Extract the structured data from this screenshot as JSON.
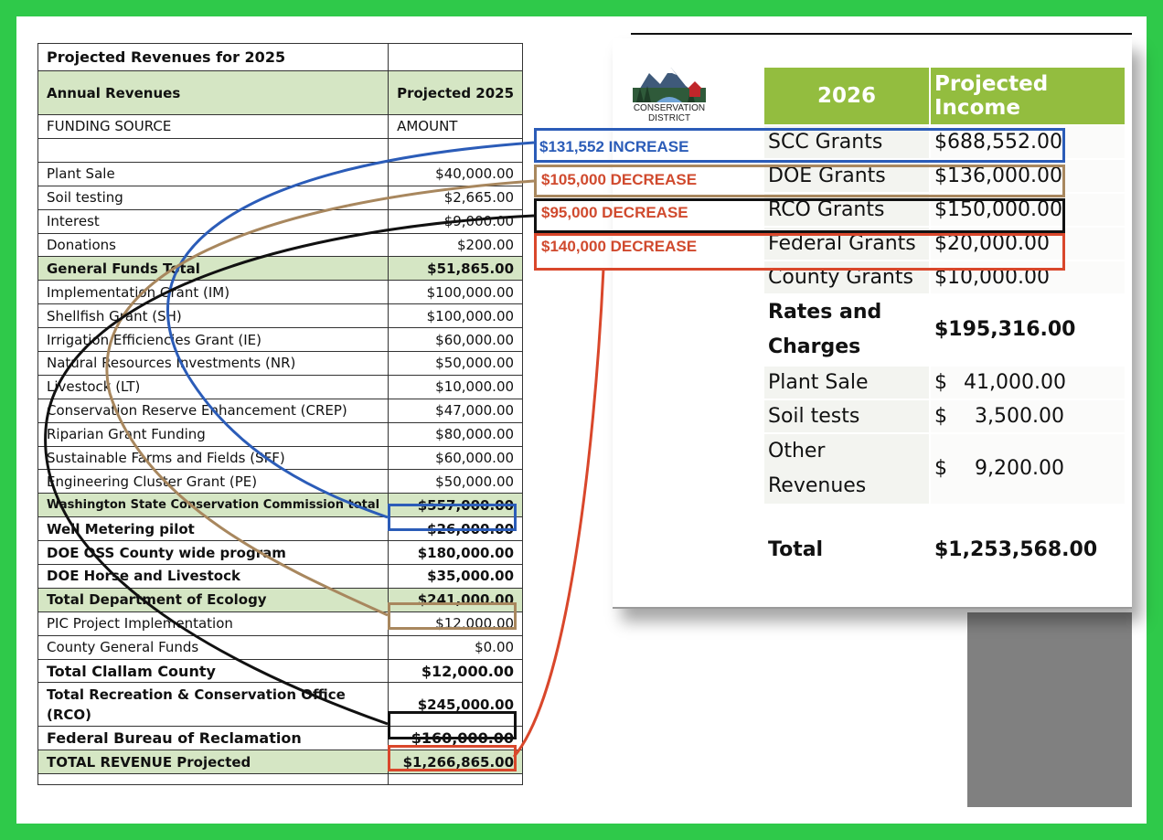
{
  "left_table": {
    "title": "Projected Revenues for 2025",
    "header": {
      "label": "Annual Revenues",
      "col": "Projected 2025"
    },
    "subheader": {
      "label": "FUNDING SOURCE",
      "col": "AMOUNT"
    },
    "rows": [
      {
        "label": "Plant Sale",
        "value": "$40,000.00"
      },
      {
        "label": "Soil testing",
        "value": "$2,665.00"
      },
      {
        "label": "Interest",
        "value": "$9,000.00"
      },
      {
        "label": "Donations",
        "value": "$200.00"
      },
      {
        "label": "General Funds Total",
        "value": "$51,865.00"
      },
      {
        "label": "Implementation Grant (IM)",
        "value": "$100,000.00"
      },
      {
        "label": "Shellfish Grant (SH)",
        "value": "$100,000.00"
      },
      {
        "label": "Irrigation Efficiencies Grant (IE)",
        "value": "$60,000.00"
      },
      {
        "label": "Natural Resources Investments (NR)",
        "value": "$50,000.00"
      },
      {
        "label": "Livestock (LT)",
        "value": "$10,000.00"
      },
      {
        "label": "Conservation Reserve Enhancement (CREP)",
        "value": "$47,000.00"
      },
      {
        "label": "Riparian Grant Funding",
        "value": "$80,000.00"
      },
      {
        "label": "Sustainable Farms and Fields (SFF)",
        "value": "$60,000.00"
      },
      {
        "label": "Engineering Cluster Grant (PE)",
        "value": "$50,000.00"
      },
      {
        "label": "Washington State Conservation Commission total",
        "value": "$557,000.00"
      },
      {
        "label": "Well Metering pilot",
        "value": "$26,000.00"
      },
      {
        "label": "DOE OSS County wide program",
        "value": "$180,000.00"
      },
      {
        "label": "DOE Horse and Livestock",
        "value": "$35,000.00"
      },
      {
        "label": "Total Department of Ecology",
        "value": "$241,000.00"
      },
      {
        "label": "PIC Project Implementation",
        "value": "$12,000.00"
      },
      {
        "label": "County General Funds",
        "value": "$0.00"
      },
      {
        "label": "Total Clallam County",
        "value": "$12,000.00"
      },
      {
        "label": "Total Recreation & Conservation Office (RCO)",
        "value": "$245,000.00"
      },
      {
        "label": "Federal Bureau of Reclamation",
        "value": "$160,000.00"
      },
      {
        "label": "TOTAL REVENUE Projected",
        "value": "$1,266,865.00"
      }
    ]
  },
  "logo": {
    "text_line1": "CONSERVATION",
    "text_line2": "DISTRICT"
  },
  "right_table": {
    "header": {
      "year": "2026",
      "col": "Projected Income"
    },
    "grants": [
      {
        "label": "SCC Grants",
        "value": "$688,552.00"
      },
      {
        "label": "DOE Grants",
        "value": "$136,000.00"
      },
      {
        "label": "RCO Grants",
        "value": "$150,000.00"
      },
      {
        "label": "Federal Grants",
        "value": "$20,000.00"
      },
      {
        "label": "County Grants",
        "value": "$10,000.00"
      }
    ],
    "rates": {
      "label_line1": "Rates and",
      "label_line2": "Charges",
      "value": "$195,316.00"
    },
    "charges": [
      {
        "label": "Plant Sale",
        "currency": "$",
        "amount": "41,000.00"
      },
      {
        "label": "Soil tests",
        "currency": "$",
        "amount": "3,500.00"
      }
    ],
    "other": {
      "label_line1": "Other",
      "label_line2": "Revenues",
      "currency": "$",
      "amount": "9,200.00"
    },
    "total": {
      "label": "Total",
      "value": "$1,253,568.00"
    }
  },
  "annotations": [
    {
      "text": "$131,552 INCREASE",
      "color": "#2b5cb8"
    },
    {
      "text": "$105,000 DECREASE",
      "color": "#d04a2e"
    },
    {
      "text": "$95,000 DECREASE",
      "color": "#d04a2e"
    },
    {
      "text": "$140,000 DECREASE",
      "color": "#d04a2e"
    }
  ],
  "colors": {
    "frame": "#2fc94a",
    "blue": "#2b5cb8",
    "tan": "#a8875e",
    "black": "#111111",
    "red": "#d9472b",
    "header_green": "#93bd3f",
    "row_green": "#d5e6c4"
  }
}
